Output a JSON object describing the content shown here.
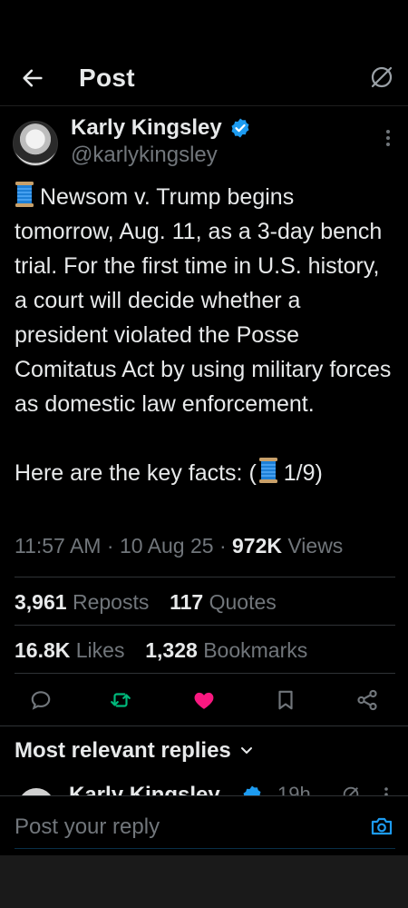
{
  "header": {
    "title": "Post"
  },
  "author": {
    "name": "Karly Kingsley",
    "handle": "@karlykingsley"
  },
  "tweet": {
    "paragraph1": "Newsom v. Trump begins tomorrow, Aug. 11, as a 3-day bench trial. For the first time in U.S. history, a court will decide whether a president violated the Posse Comitatus Act by using military forces as domestic law enforcement.",
    "paragraph2_prefix": "Here are the key facts: (",
    "paragraph2_suffix": "1/9)"
  },
  "meta": {
    "time": "11:57 AM",
    "date": "10 Aug 25",
    "views_count": "972K",
    "views_label": "Views"
  },
  "stats": {
    "reposts_count": "3,961",
    "reposts_label": "Reposts",
    "quotes_count": "117",
    "quotes_label": "Quotes",
    "likes_count": "16.8K",
    "likes_label": "Likes",
    "bookmarks_count": "1,328",
    "bookmarks_label": "Bookmarks"
  },
  "actions": {
    "icons": [
      "reply-icon",
      "repost-icon",
      "like-icon",
      "bookmark-icon",
      "share-icon"
    ],
    "like_color": "#f91880",
    "repost_color": "#00ba7c",
    "muted_color": "#71767b"
  },
  "replies": {
    "heading": "Most relevant replies",
    "peek_name": "Karly Kingsley",
    "peek_time": "19h"
  },
  "reply_bar": {
    "placeholder": "Post your reply"
  },
  "colors": {
    "background": "#000000",
    "text": "#e7e9ea",
    "muted": "#71767b",
    "accent": "#1d9bf0"
  }
}
